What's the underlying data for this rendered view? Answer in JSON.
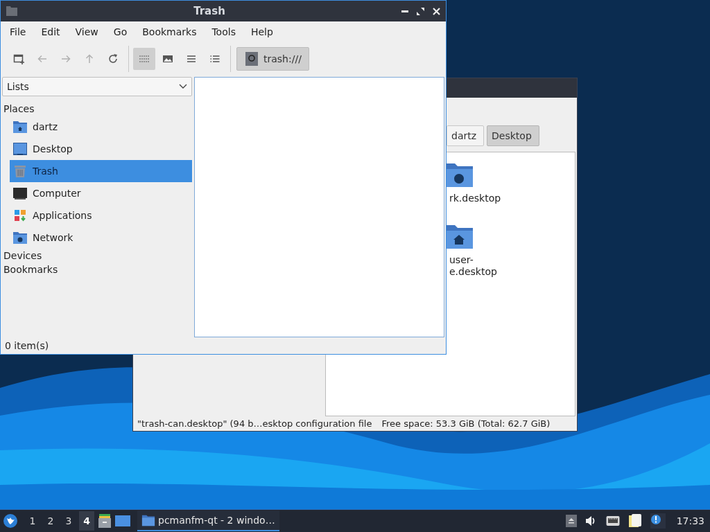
{
  "back_window": {
    "path_buttons": [
      {
        "label": "dartz",
        "selected": false
      },
      {
        "label": "Desktop",
        "selected": true
      }
    ],
    "files": [
      {
        "kind": "network",
        "lines": [
          "rk.desktop"
        ]
      },
      {
        "kind": "home",
        "lines": [
          "user-",
          "e.desktop"
        ]
      }
    ],
    "status_bar": [
      "\"trash-can.desktop\" (94 b…esktop configuration file",
      "Free space: 53.3 GiB (Total: 62.7 GiB)"
    ]
  },
  "front_window": {
    "title": "Trash",
    "menu": [
      "File",
      "Edit",
      "View",
      "Go",
      "Bookmarks",
      "Tools",
      "Help"
    ],
    "toolbar": [
      {
        "kind": "new-window",
        "disabled": false
      },
      {
        "kind": "back",
        "disabled": true
      },
      {
        "kind": "forward",
        "disabled": true
      },
      {
        "kind": "up",
        "disabled": true
      },
      {
        "kind": "reload",
        "disabled": false
      }
    ],
    "view_modes": [
      {
        "kind": "icon-view",
        "selected": true
      },
      {
        "kind": "thumbnail-view",
        "selected": false
      },
      {
        "kind": "compact-view",
        "selected": false
      },
      {
        "kind": "detailed-view",
        "selected": false
      }
    ],
    "location": "trash:///",
    "side_pane": {
      "mode": "Lists",
      "sections": [
        {
          "label": "Places",
          "items": [
            {
              "kind": "home",
              "label": "dartz",
              "selected": false
            },
            {
              "kind": "desktop",
              "label": "Desktop",
              "selected": false
            },
            {
              "kind": "trash",
              "label": "Trash",
              "selected": true
            },
            {
              "kind": "computer",
              "label": "Computer",
              "selected": false
            },
            {
              "kind": "applications",
              "label": "Applications",
              "selected": false
            },
            {
              "kind": "network",
              "label": "Network",
              "selected": false
            }
          ]
        },
        {
          "label": "Devices"
        },
        {
          "label": "Bookmarks"
        }
      ]
    },
    "status_bar": "0 item(s)"
  },
  "taskbar": {
    "desktops": [
      {
        "label": "1",
        "selected": false
      },
      {
        "label": "2",
        "selected": false
      },
      {
        "label": "3",
        "selected": false
      },
      {
        "label": "4",
        "selected": true
      }
    ],
    "launchers": [
      {
        "kind": "file-cabinet"
      },
      {
        "kind": "desktop"
      }
    ],
    "tasks": [
      {
        "label": "pcmanfm-qt - 2 windo…",
        "selected": true
      }
    ],
    "tray": [
      {
        "kind": "eject"
      },
      {
        "kind": "volume"
      },
      {
        "kind": "network"
      },
      {
        "kind": "notes"
      },
      {
        "kind": "notification"
      }
    ],
    "clock": "17:33"
  }
}
